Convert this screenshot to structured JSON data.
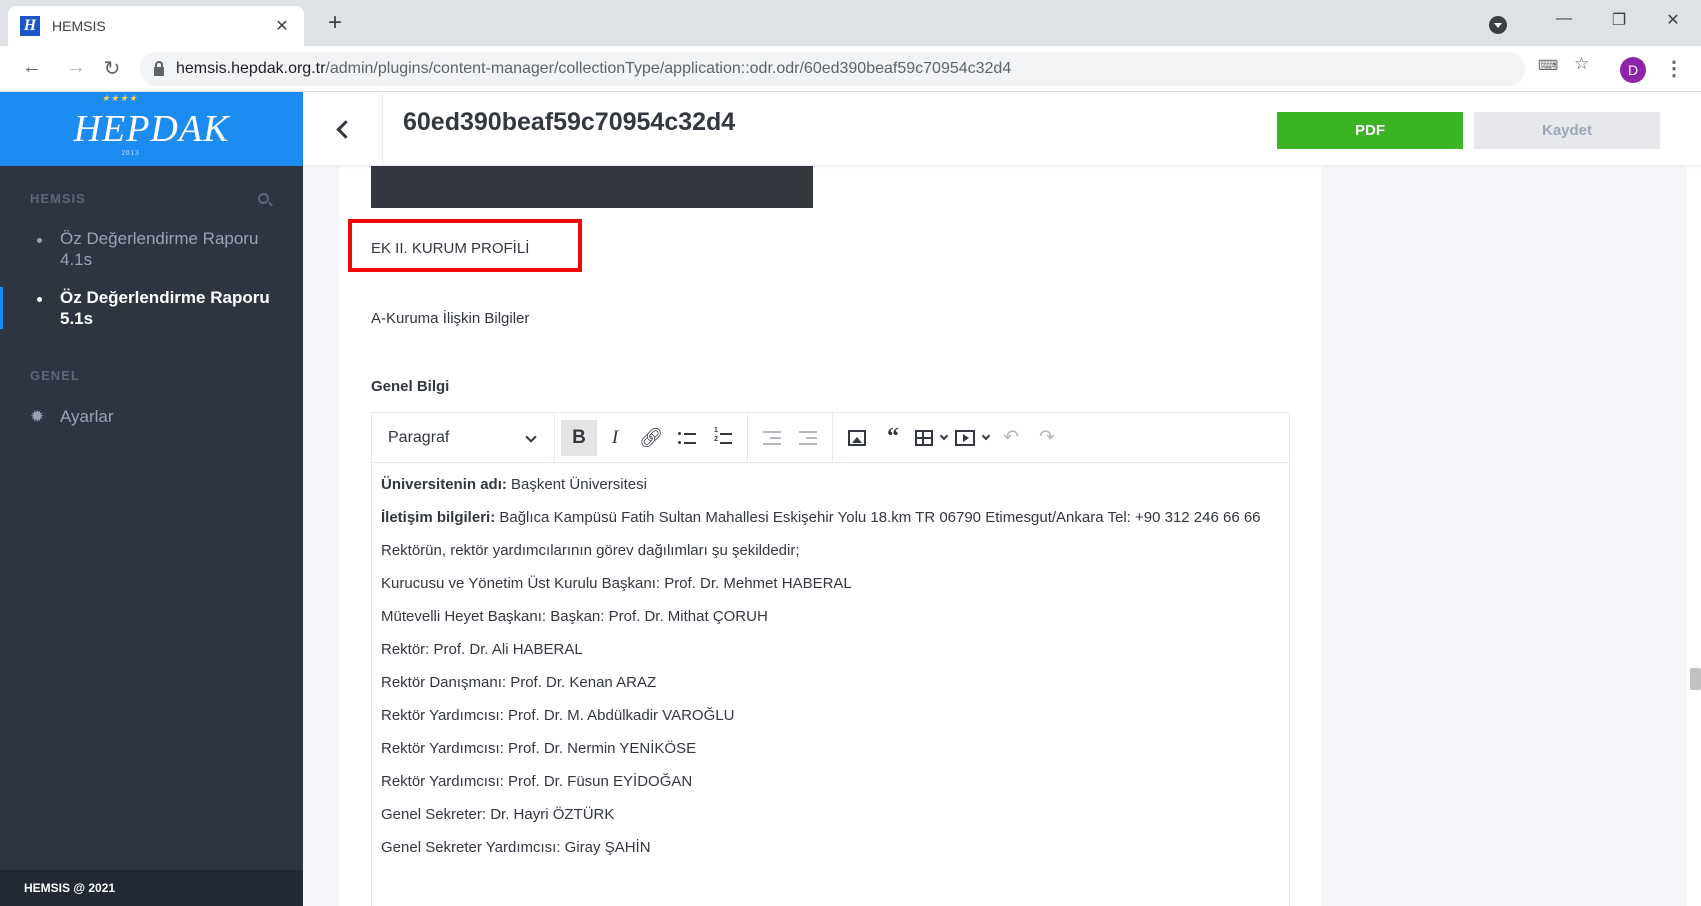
{
  "browser": {
    "tab_title": "HEMSIS",
    "tab_favicon": "H",
    "url_host": "hemsis.hepdak.org.tr",
    "url_path": "/admin/plugins/content-manager/collectionType/application::odr.odr/60ed390beaf59c70954c32d4",
    "profile_initial": "D"
  },
  "sidebar": {
    "brand": "HEPDAK",
    "brand_year": "2013",
    "section_hemsis": "HEMSIS",
    "items": [
      {
        "label": "Öz Değerlendirme Raporu 4.1s"
      },
      {
        "label": "Öz Değerlendirme Raporu 5.1s"
      }
    ],
    "section_general": "GENEL",
    "settings_label": "Ayarlar",
    "footer": "HEMSIS @ 2021"
  },
  "header": {
    "title": "60ed390beaf59c70954c32d4",
    "pdf_label": "PDF",
    "save_label": "Kaydet"
  },
  "content": {
    "heading": "EK II. KURUM PROFİLİ",
    "subheading": "A-Kuruma İlişkin Bilgiler",
    "field_label": "Genel Bilgi",
    "editor": {
      "paragraph_select": "Paragraf",
      "lines": [
        {
          "bold": "Üniversitenin adı:",
          "text": " Başkent Üniversitesi"
        },
        {
          "bold": "İletişim bilgileri:",
          "text": " Bağlıca Kampüsü Fatih Sultan Mahallesi Eskişehir Yolu 18.km TR 06790 Etimesgut/Ankara Tel: +90 312 246 66 66"
        },
        {
          "bold": "",
          "text": "Rektörün, rektör yardımcılarının görev dağılımları şu şekildedir;"
        },
        {
          "bold": "",
          "text": "Kurucusu ve Yönetim Üst Kurulu Başkanı: Prof. Dr. Mehmet HABERAL"
        },
        {
          "bold": "",
          "text": "Mütevelli Heyet Başkanı: Başkan: Prof. Dr. Mithat ÇORUH"
        },
        {
          "bold": "",
          "text": "Rektör: Prof. Dr. Ali HABERAL"
        },
        {
          "bold": "",
          "text": "Rektör Danışmanı: Prof. Dr. Kenan ARAZ"
        },
        {
          "bold": "",
          "text": "Rektör Yardımcısı: Prof. Dr. M. Abdülkadir VAROĞLU"
        },
        {
          "bold": "",
          "text": "Rektör Yardımcısı: Prof. Dr. Nermin YENİKÖSE"
        },
        {
          "bold": "",
          "text": "Rektör Yardımcısı: Prof. Dr. Füsun EYİDOĞAN"
        },
        {
          "bold": "",
          "text": "Genel Sekreter: Dr. Hayri ÖZTÜRK"
        },
        {
          "bold": "",
          "text": "Genel Sekreter Yardımcısı: Giray ŞAHİN"
        }
      ]
    }
  },
  "colors": {
    "sidebar_bg": "#2e3541",
    "brand_bg": "#1c8cf2",
    "pdf_button": "#3bb423",
    "highlight_box": "#ec0a0a"
  }
}
